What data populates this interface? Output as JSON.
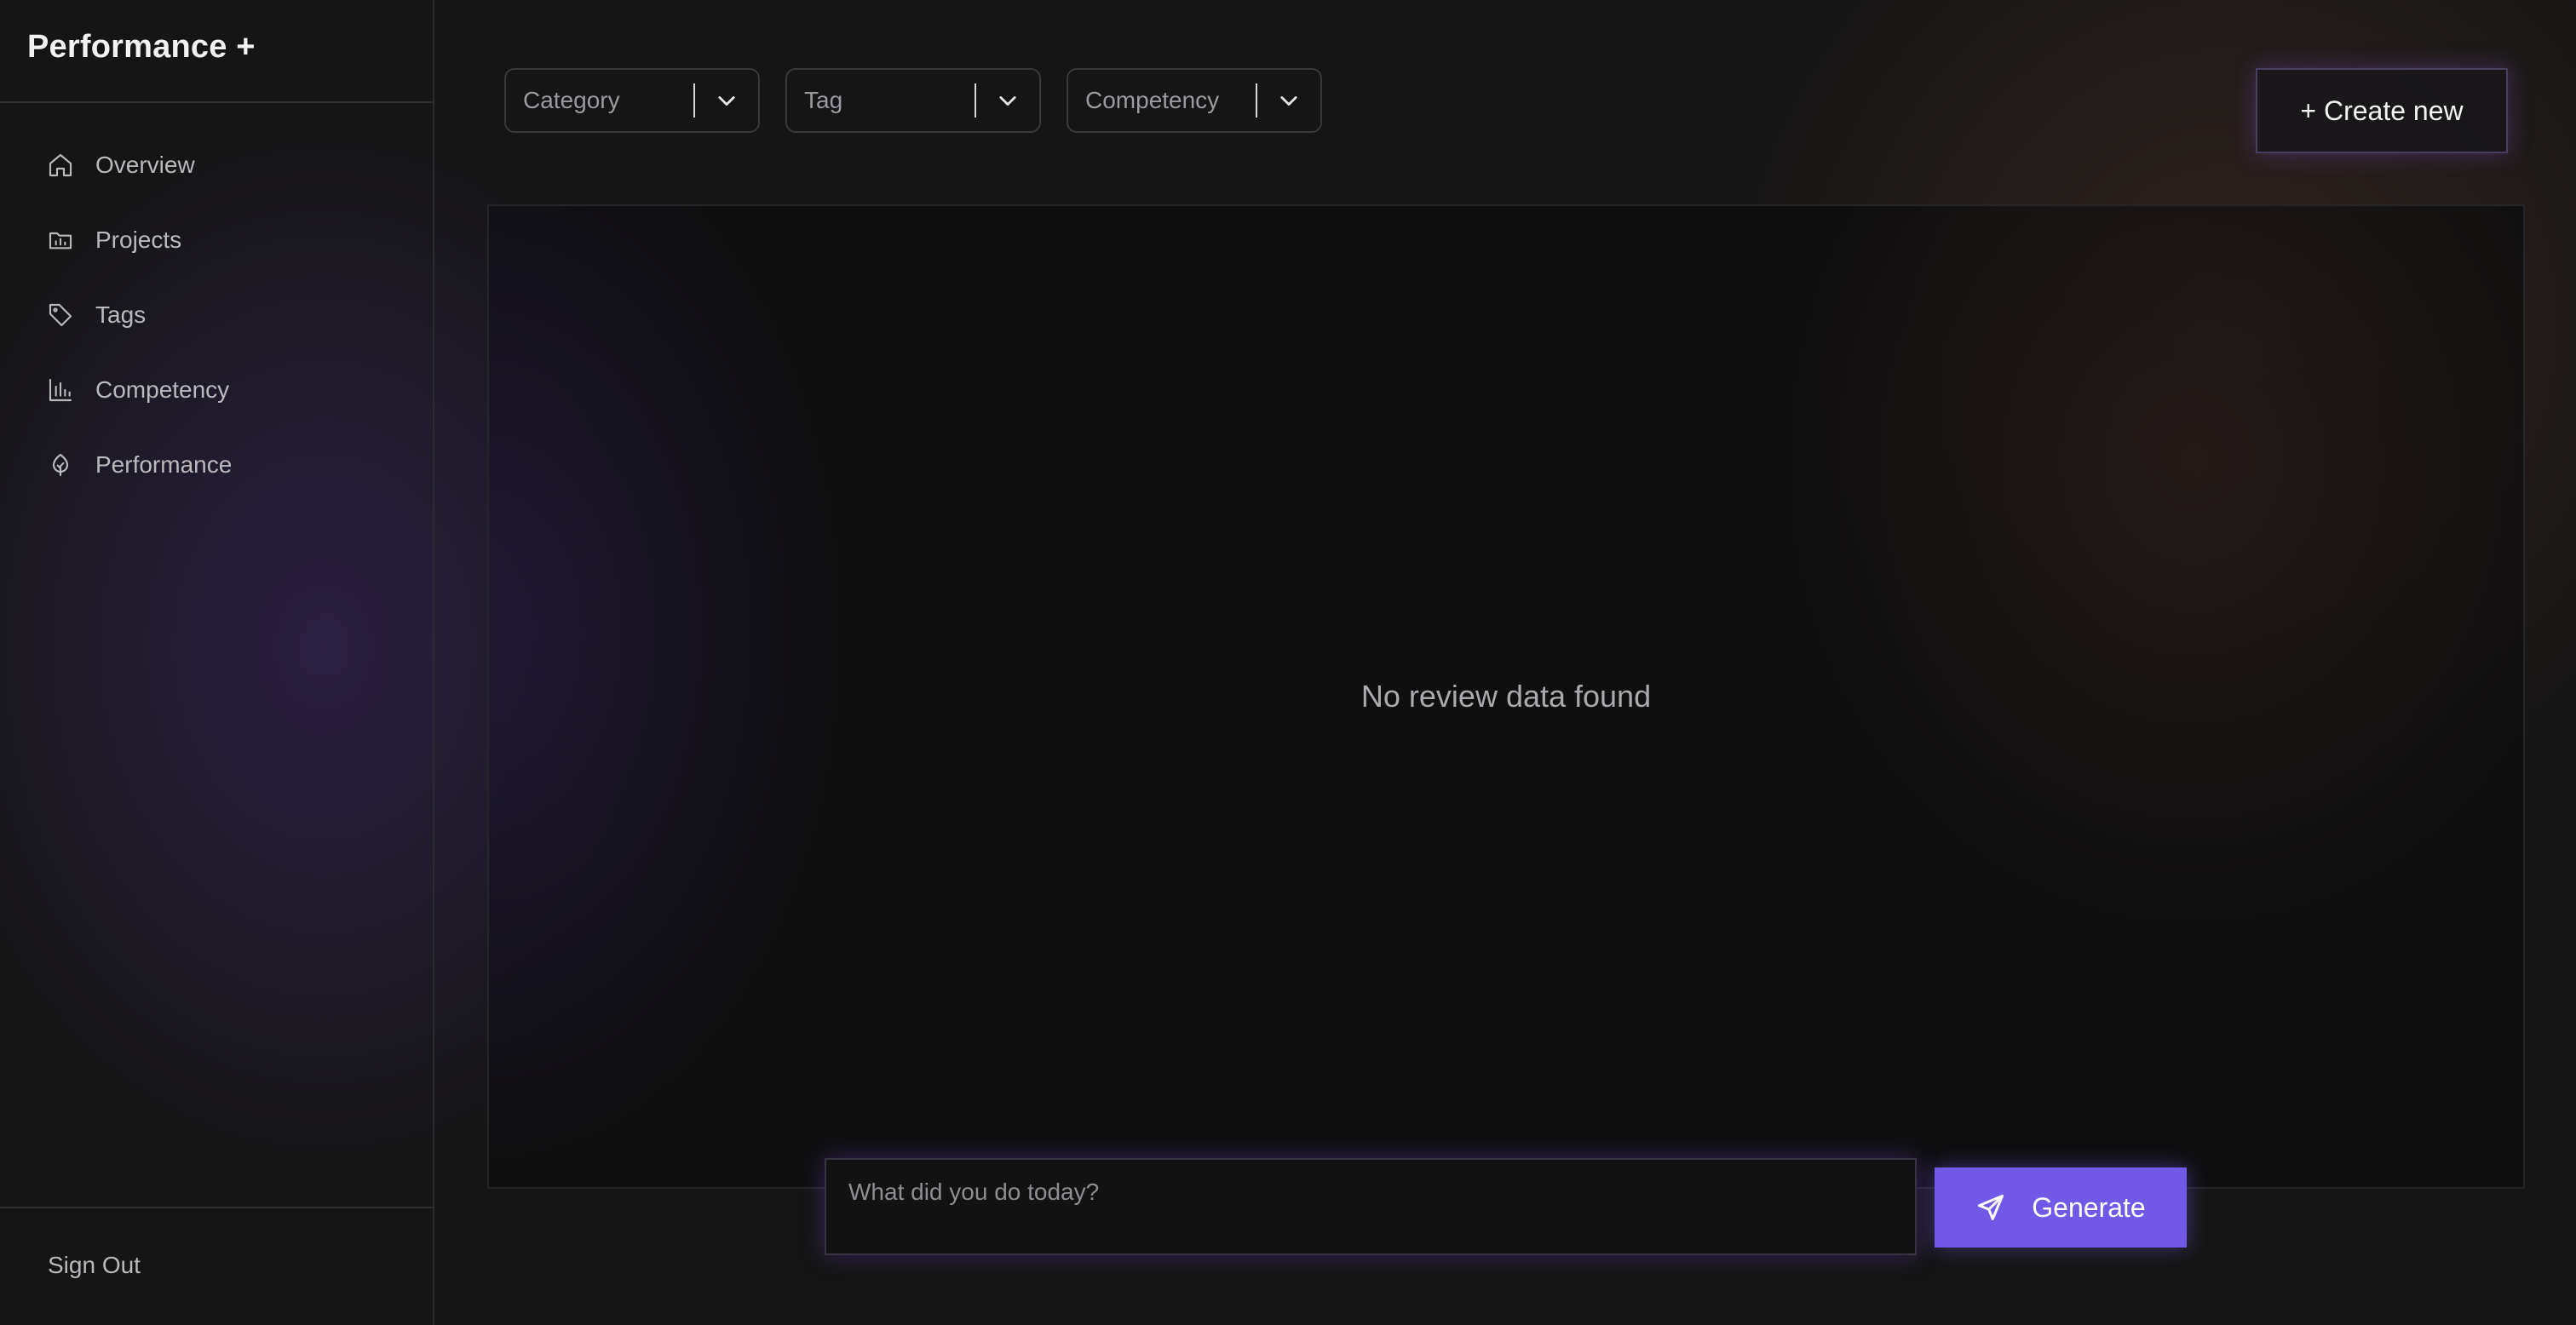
{
  "app": {
    "title": "Performance +"
  },
  "sidebar": {
    "items": [
      {
        "label": "Overview",
        "icon": "home-icon"
      },
      {
        "label": "Projects",
        "icon": "folder-chart-icon"
      },
      {
        "label": "Tags",
        "icon": "tag-icon"
      },
      {
        "label": "Competency",
        "icon": "bar-chart-icon"
      },
      {
        "label": "Performance",
        "icon": "sprout-icon"
      }
    ],
    "sign_out_label": "Sign Out"
  },
  "filters": [
    {
      "label": "Category",
      "icon": "chevron-down-icon"
    },
    {
      "label": "Tag",
      "icon": "chevron-down-icon"
    },
    {
      "label": "Competency",
      "icon": "chevron-down-icon"
    }
  ],
  "header": {
    "create_label": "+ Create new"
  },
  "main": {
    "empty_message": "No review data found"
  },
  "prompt": {
    "placeholder": "What did you do today?",
    "value": "",
    "generate_label": "Generate",
    "generate_icon": "send-icon"
  },
  "colors": {
    "accent": "#7258e6",
    "background": "#151515",
    "text_muted": "#b9b9be"
  }
}
